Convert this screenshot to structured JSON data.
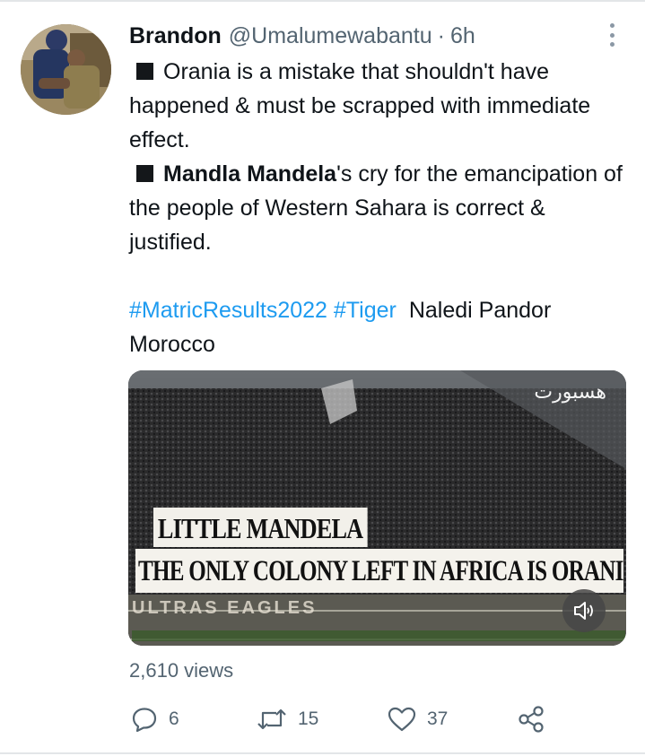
{
  "tweet": {
    "author_name": "Brandon",
    "handle": "@Umalumewabantu",
    "separator": "·",
    "time": "6h",
    "body": {
      "bullet1": "Orania is a mistake that shouldn't have happened & must be scrapped with immediate effect.",
      "bullet2_bold": "Mandla Mandela",
      "bullet2_rest": "'s cry for the emancipation of the people of Western Sahara is correct & justified.",
      "hashtag1": "#MatricResults2022",
      "hashtag2": "#Tiger",
      "trail_text": "Naledi Pandor Morocco"
    },
    "media": {
      "watermark": "هسبورت",
      "banner_top": "LITTLE MANDELA",
      "banner_main": "THE ONLY COLONY LEFT IN AFRICA IS ORANIA",
      "banner_low": "ULTRAS  EAGLES",
      "sound_icon": "speaker-muted-icon"
    },
    "views": "2,610 views",
    "actions": {
      "reply_count": "6",
      "retweet_count": "15",
      "like_count": "37"
    }
  },
  "colors": {
    "link": "#1d9bf0",
    "secondary_text": "#536471",
    "primary_text": "#0f1419"
  }
}
